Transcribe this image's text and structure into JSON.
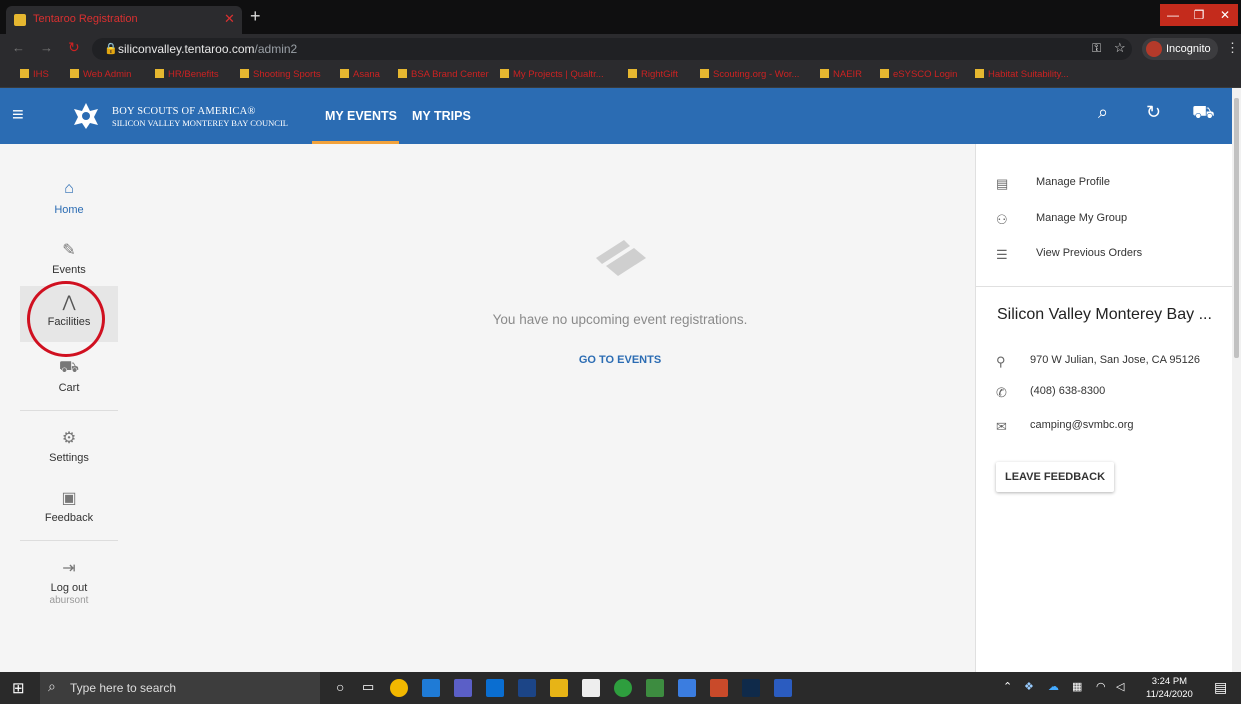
{
  "browser": {
    "tab_title": "Tentaroo Registration",
    "url_host": "siliconvalley.tentaroo.com",
    "url_path": "/admin2",
    "incognito_label": "Incognito",
    "bookmarks": [
      "IHS",
      "Web Admin",
      "HR/Benefits",
      "Shooting Sports",
      "Asana",
      "BSA Brand Center",
      "My Projects | Qualtr...",
      "RightGift",
      "Scouting.org - Wor...",
      "NAEIR",
      "eSYSCO Login",
      "Habitat Suitability..."
    ]
  },
  "header": {
    "org_line1": "BOY SCOUTS OF AMERICA®",
    "org_line2": "SILICON VALLEY MONTEREY BAY COUNCIL",
    "nav": [
      "MY EVENTS",
      "MY TRIPS"
    ],
    "accent": "#2b6cb3",
    "active_underline": "#f2a23b"
  },
  "sidebar": {
    "items": [
      {
        "label": "Home",
        "icon": "home-icon"
      },
      {
        "label": "Events",
        "icon": "ticket-icon"
      },
      {
        "label": "Facilities",
        "icon": "tent-icon"
      },
      {
        "label": "Cart",
        "icon": "cart-icon"
      },
      {
        "label": "Settings",
        "icon": "gear-icon"
      },
      {
        "label": "Feedback",
        "icon": "feedback-icon"
      },
      {
        "label": "Log out",
        "icon": "logout-icon"
      }
    ],
    "username": "abursont"
  },
  "main": {
    "empty_message": "You have no upcoming event registrations.",
    "go_to_events": "GO TO EVENTS"
  },
  "right_panel": {
    "links": [
      "Manage Profile",
      "Manage My Group",
      "View Previous Orders"
    ],
    "council_name": "Silicon Valley Monterey Bay ...",
    "address": "970 W Julian, San Jose, CA 95126",
    "phone": "(408) 638-8300",
    "email": "camping@svmbc.org",
    "feedback_button": "LEAVE FEEDBACK"
  },
  "taskbar": {
    "search_placeholder": "Type here to search",
    "time": "3:24 PM",
    "date": "11/24/2020"
  }
}
